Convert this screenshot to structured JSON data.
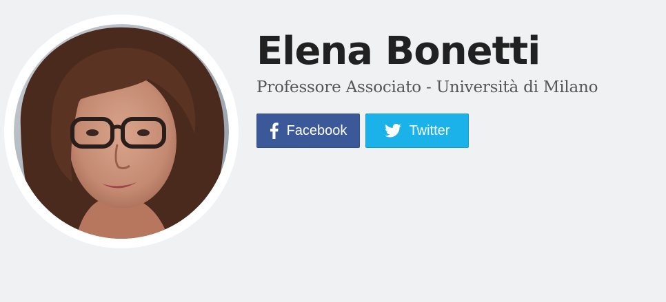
{
  "profile": {
    "name": "Elena Bonetti",
    "subtitle": "Professore Associato - Università di Milano",
    "avatar_alt": "Elena Bonetti"
  },
  "social": {
    "facebook": {
      "label": "Facebook",
      "icon": "facebook-icon",
      "color": "#3b5998"
    },
    "twitter": {
      "label": "Twitter",
      "icon": "twitter-icon",
      "color": "#1ab2e8"
    }
  },
  "colors": {
    "background": "#f0f1f3",
    "name": "#212121",
    "subtitle": "#555555"
  }
}
